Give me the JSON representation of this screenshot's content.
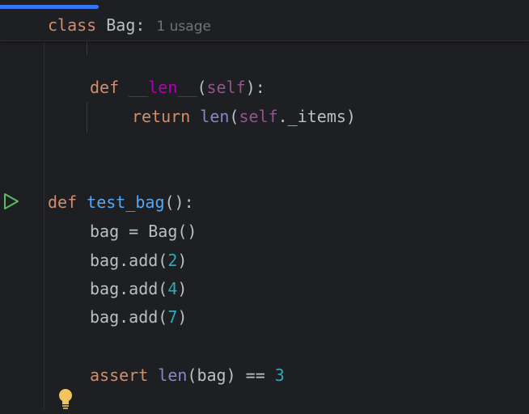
{
  "sticky_header": {
    "keyword": "class",
    "name": "Bag:",
    "usage_hint": "1 usage"
  },
  "code": {
    "len_def": {
      "keyword": "def",
      "name": "__len__",
      "open": "(",
      "param": "self",
      "close": "):"
    },
    "len_return": {
      "keyword": "return",
      "builtin": "len",
      "open": "(",
      "self": "self",
      "attr": "._items)"
    },
    "test_def": {
      "keyword": "def",
      "name": "test_bag",
      "rest": "():"
    },
    "line_bag_assign": "bag = Bag()",
    "add_calls": [
      {
        "prefix": "bag.add(",
        "arg": "2",
        "suffix": ")"
      },
      {
        "prefix": "bag.add(",
        "arg": "4",
        "suffix": ")"
      },
      {
        "prefix": "bag.add(",
        "arg": "7",
        "suffix": ")"
      }
    ],
    "assert_line": {
      "keyword": "assert",
      "builtin": "len",
      "middle": "(bag) == ",
      "value": "3"
    }
  },
  "icons": {
    "run": "run-icon",
    "intention": "lightbulb-icon"
  },
  "colors": {
    "background": "#1e1f22",
    "keyword": "#cf8e6d",
    "function": "#56a8f5",
    "dunder": "#b200b2",
    "self": "#94558d",
    "builtin": "#8888c6",
    "number": "#2aacb8",
    "text": "#bcbec4",
    "progress": "#3574f0"
  }
}
